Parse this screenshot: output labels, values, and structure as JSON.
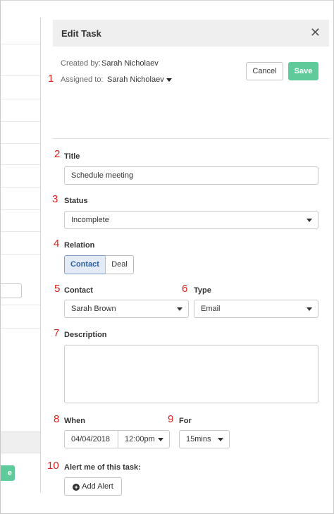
{
  "panel": {
    "title": "Edit Task",
    "close_symbol": "✕"
  },
  "meta": {
    "created_by_label": "Created by:",
    "created_by_value": "Sarah Nicholaev",
    "assigned_to_label": "Assigned to:",
    "assigned_to_value": "Sarah Nicholaev"
  },
  "buttons": {
    "cancel": "Cancel",
    "save": "Save",
    "add_alert": "Add Alert"
  },
  "markers": [
    "1",
    "2",
    "3",
    "4",
    "5",
    "6",
    "7",
    "8",
    "9",
    "10"
  ],
  "fields": {
    "title_label": "Title",
    "title_value": "Schedule meeting",
    "status_label": "Status",
    "status_value": "Incomplete",
    "relation_label": "Relation",
    "relation_options": [
      "Contact",
      "Deal"
    ],
    "relation_selected": "Contact",
    "contact_label": "Contact",
    "contact_value": "Sarah Brown",
    "type_label": "Type",
    "type_value": "Email",
    "description_label": "Description",
    "description_value": "",
    "when_label": "When",
    "when_date": "04/04/2018",
    "when_time": "12:00pm",
    "for_label": "For",
    "for_value": "15mins",
    "alert_label": "Alert me of this task:"
  },
  "background": {
    "green_button_text": "e"
  },
  "icons": {
    "close": "close-icon",
    "add_alert": "plus-circle-icon",
    "dropdown": "chevron-down-icon"
  },
  "colors": {
    "save_green": "#5fcb9b",
    "marker_red": "#e0201b",
    "header_bg": "#efefef",
    "selected_segment_bg": "#e2ebf6"
  }
}
